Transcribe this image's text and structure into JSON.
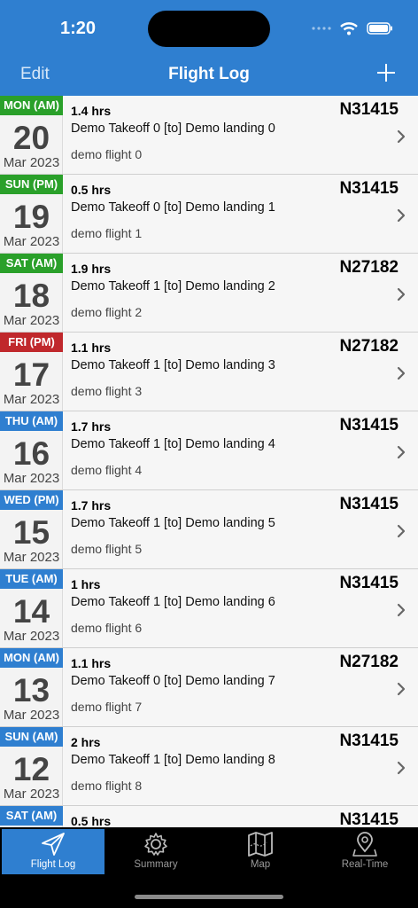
{
  "status": {
    "time": "1:20"
  },
  "nav": {
    "left_label": "Edit",
    "title": "Flight Log"
  },
  "colors": {
    "header": "#2f7fd0",
    "green": "#2aa02a",
    "blue": "#2f7fd0",
    "red": "#c0282c"
  },
  "flights": [
    {
      "day": "MON (AM)",
      "color": "#2aa02a",
      "date": "20",
      "month_year": "Mar 2023",
      "hours": "1.4 hrs",
      "tail": "N31415",
      "route": "Demo Takeoff 0 [to] Demo landing 0",
      "note": "demo flight 0"
    },
    {
      "day": "SUN (PM)",
      "color": "#2aa02a",
      "date": "19",
      "month_year": "Mar 2023",
      "hours": "0.5 hrs",
      "tail": "N31415",
      "route": "Demo Takeoff 0 [to] Demo landing 1",
      "note": "demo flight 1"
    },
    {
      "day": "SAT (AM)",
      "color": "#2aa02a",
      "date": "18",
      "month_year": "Mar 2023",
      "hours": "1.9 hrs",
      "tail": "N27182",
      "route": "Demo Takeoff 1 [to] Demo landing 2",
      "note": "demo flight 2"
    },
    {
      "day": "FRI (PM)",
      "color": "#c0282c",
      "date": "17",
      "month_year": "Mar 2023",
      "hours": "1.1 hrs",
      "tail": "N27182",
      "route": "Demo Takeoff 1 [to] Demo landing 3",
      "note": "demo flight 3"
    },
    {
      "day": "THU (AM)",
      "color": "#2f7fd0",
      "date": "16",
      "month_year": "Mar 2023",
      "hours": "1.7 hrs",
      "tail": "N31415",
      "route": "Demo Takeoff 1 [to] Demo landing 4",
      "note": "demo flight 4"
    },
    {
      "day": "WED (PM)",
      "color": "#2f7fd0",
      "date": "15",
      "month_year": "Mar 2023",
      "hours": "1.7 hrs",
      "tail": "N31415",
      "route": "Demo Takeoff 1 [to] Demo landing 5",
      "note": "demo flight 5"
    },
    {
      "day": "TUE (AM)",
      "color": "#2f7fd0",
      "date": "14",
      "month_year": "Mar 2023",
      "hours": "1 hrs",
      "tail": "N31415",
      "route": "Demo Takeoff 1 [to] Demo landing 6",
      "note": "demo flight 6"
    },
    {
      "day": "MON (AM)",
      "color": "#2f7fd0",
      "date": "13",
      "month_year": "Mar 2023",
      "hours": "1.1 hrs",
      "tail": "N27182",
      "route": "Demo Takeoff 0 [to] Demo landing 7",
      "note": "demo flight 7"
    },
    {
      "day": "SUN (AM)",
      "color": "#2f7fd0",
      "date": "12",
      "month_year": "Mar 2023",
      "hours": "2 hrs",
      "tail": "N31415",
      "route": "Demo Takeoff 1 [to] Demo landing 8",
      "note": "demo flight 8"
    },
    {
      "day": "SAT (AM)",
      "color": "#2f7fd0",
      "date": "",
      "month_year": "",
      "hours": "0.5 hrs",
      "tail": "N31415",
      "route": "",
      "note": ""
    }
  ],
  "tabs": [
    {
      "label": "Flight Log",
      "icon": "paper-plane-icon",
      "active": true
    },
    {
      "label": "Summary",
      "icon": "gear-icon",
      "active": false
    },
    {
      "label": "Map",
      "icon": "map-icon",
      "active": false
    },
    {
      "label": "Real-Time",
      "icon": "location-pin-icon",
      "active": false
    }
  ]
}
